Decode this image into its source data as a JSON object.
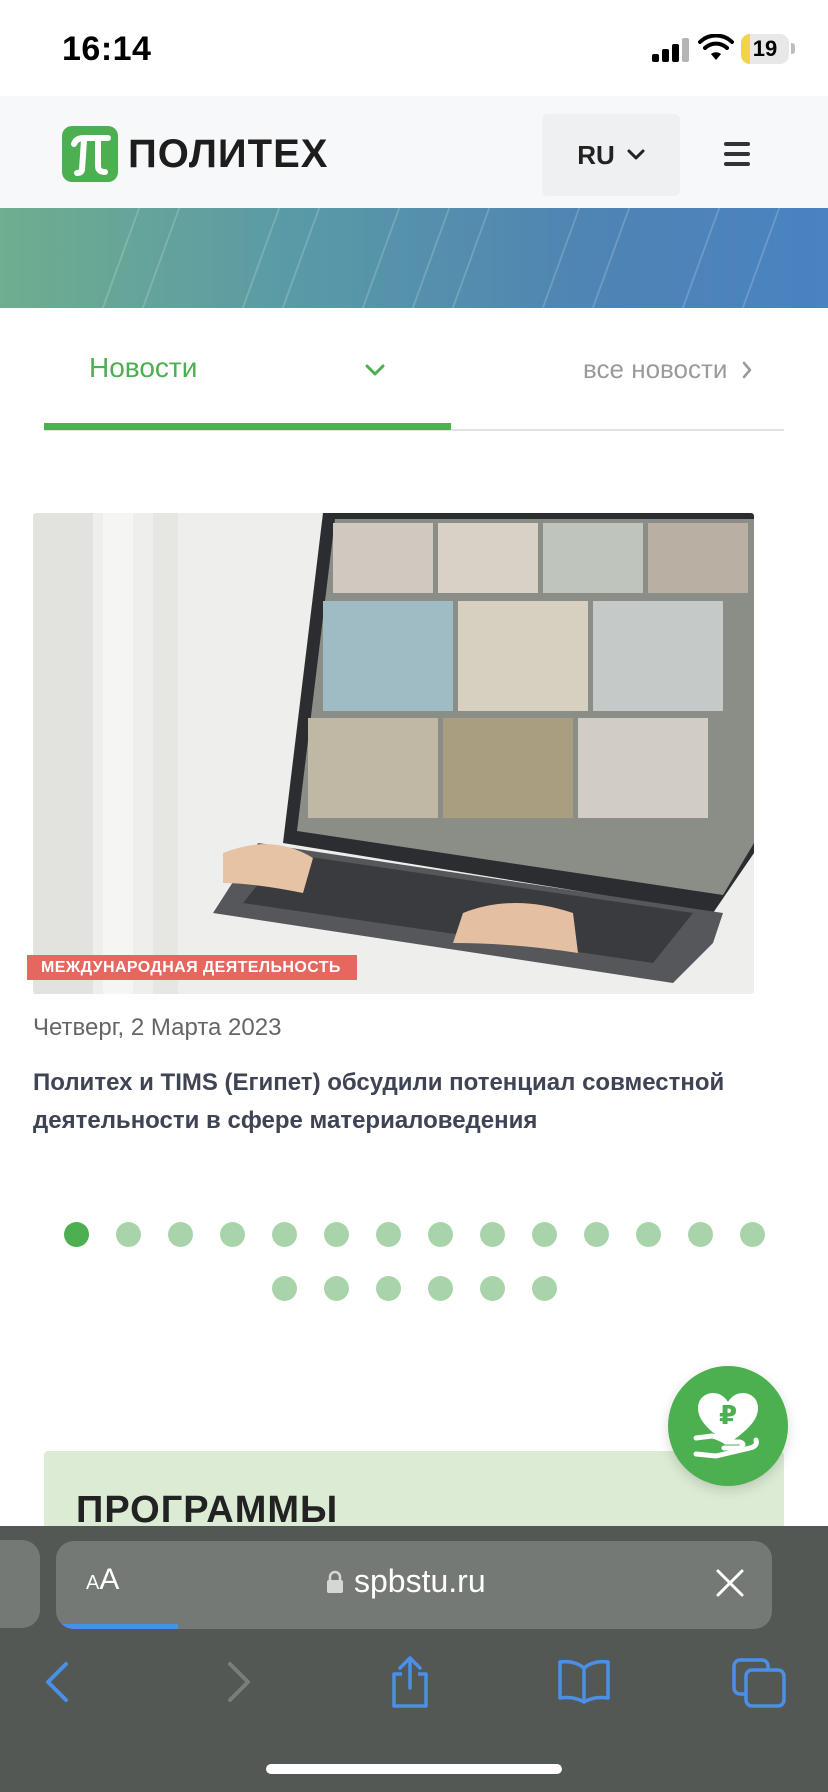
{
  "status_bar": {
    "time": "16:14",
    "battery": "19",
    "battery_level_percent": 19
  },
  "header": {
    "logo_text": "ПОЛИТЕХ",
    "language": "RU"
  },
  "news": {
    "tab_label": "Новости",
    "all_news_label": "все новости",
    "card": {
      "tag": "МЕЖДУНАРОДНАЯ ДЕЯТЕЛЬНОСТЬ",
      "date": "Четверг, 2 Марта 2023",
      "title": "Политех и TIMS (Египет) обсудили потенциал совместной деятельности в сфере материаловедения"
    },
    "pagination": {
      "total": 20,
      "active_index": 0,
      "first_row_count": 14
    }
  },
  "programs": {
    "title": "ПРОГРАММЫ"
  },
  "browser": {
    "text_size_small": "A",
    "text_size_large": "A",
    "domain": "spbstu.ru",
    "load_progress_fraction": 0.17
  },
  "colors": {
    "brand_green": "#4caf50",
    "tag_red": "#e5675f",
    "dot_inactive": "#a9d4aa",
    "safari_toolbar": "#545854",
    "ios_blue": "#4a8fe8"
  },
  "icons": [
    "signal-icon",
    "wifi-icon",
    "battery-icon",
    "chevron-down-icon",
    "menu-icon",
    "chevron-right-icon",
    "donate-icon",
    "lock-icon",
    "close-icon",
    "back-icon",
    "forward-icon",
    "share-icon",
    "bookmarks-icon",
    "tabs-icon"
  ]
}
